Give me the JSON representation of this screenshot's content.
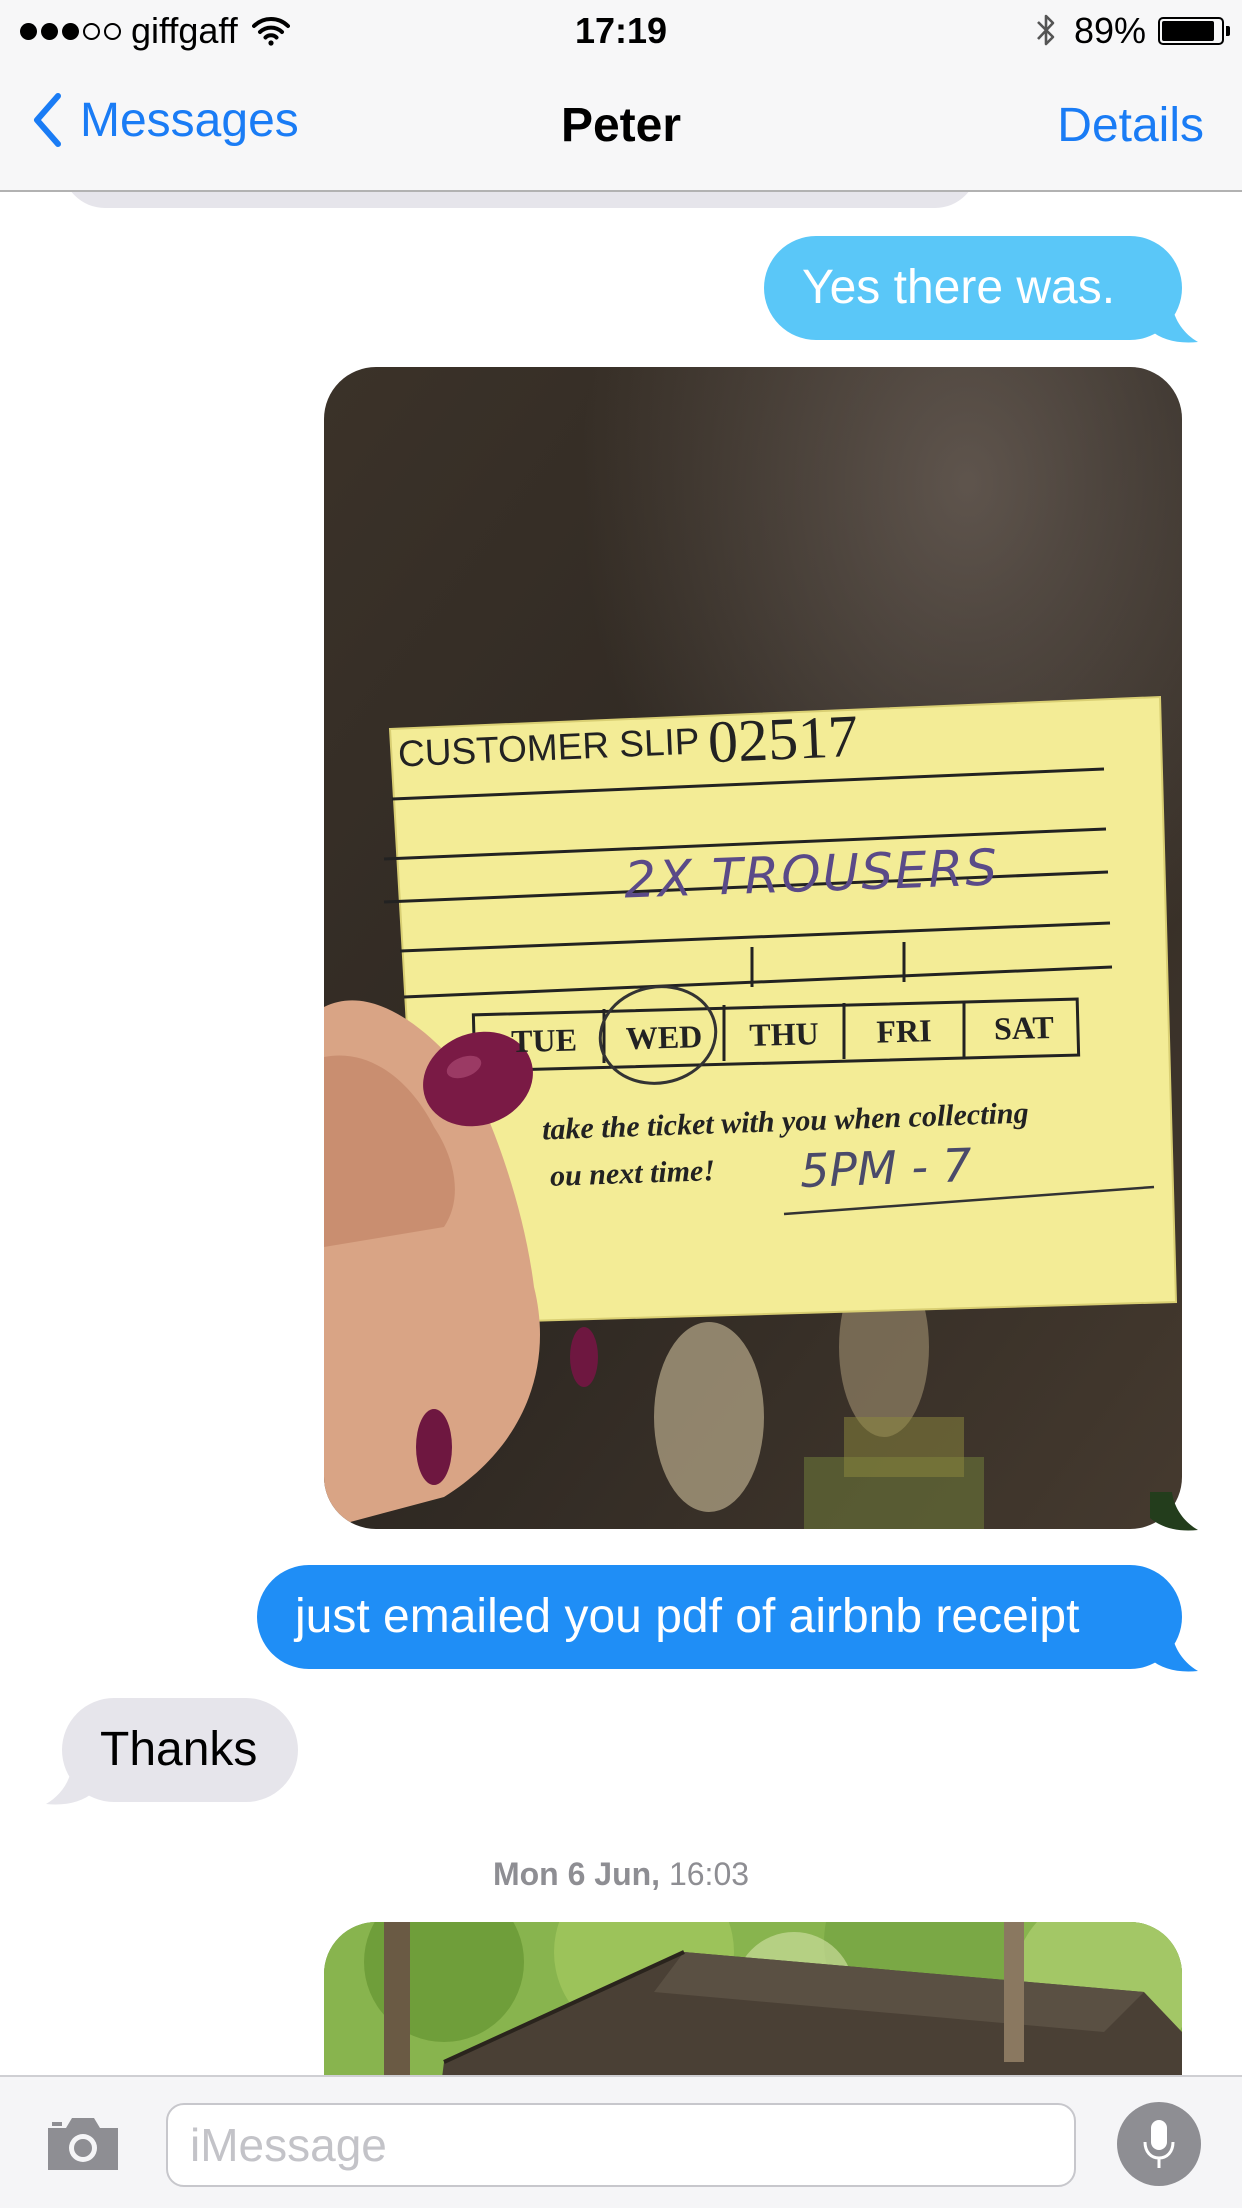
{
  "status_bar": {
    "carrier": "giffgaff",
    "time": "17:19",
    "battery_percent_label": "89%",
    "battery_level": 0.89,
    "signal_bars_filled": 3,
    "signal_bars_total": 5
  },
  "nav": {
    "back_label": "Messages",
    "title": "Peter",
    "details_label": "Details"
  },
  "messages": [
    {
      "kind": "sent-sms",
      "text": "Yes there was."
    },
    {
      "kind": "sent-photo"
    },
    {
      "kind": "sent-imessage",
      "text": "just emailed you pdf of airbnb receipt"
    },
    {
      "kind": "received",
      "text": "Thanks"
    },
    {
      "kind": "sent-photo"
    }
  ],
  "timestamp": {
    "day": "Mon 6 Jun,",
    "time": "16:03"
  },
  "photo_slip": {
    "title": "CUSTOMER SLIP",
    "number": "02517",
    "handwritten_item": "2X TROUSERS",
    "days": [
      "TUE",
      "WED",
      "THU",
      "FRI",
      "SAT"
    ],
    "footer_line1": "take the ticket with you when collecting",
    "footer_line2": "ou next time!",
    "handwritten_time": "5PM - 7"
  },
  "input": {
    "placeholder": "iMessage"
  },
  "colors": {
    "ios_blue": "#1a7cf5",
    "sms_bubble": "#5ac7f8",
    "imessage_bubble": "#1f8ef6",
    "received_bubble": "#e6e5eb"
  }
}
